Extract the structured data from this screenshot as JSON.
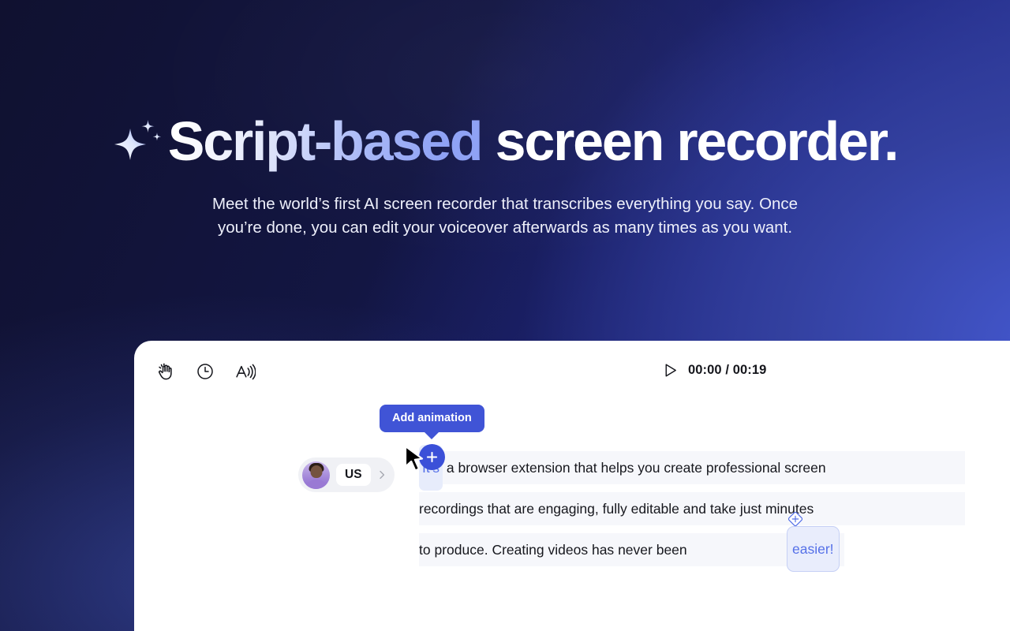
{
  "hero": {
    "headline_part1": "Script-based",
    "headline_part2": " screen recorder.",
    "subheadline": "Meet the world’s first AI screen recorder that transcribes everything you say. Once you’re done, you can edit your voiceover afterwards as many times as you want.",
    "sparkle_icon": "sparkle-icon",
    "colors": {
      "bg_dark": "#101130",
      "bg_blue": "#3a4ac2",
      "accent": "#4054d6",
      "headline_gradient_start": "#ffffff",
      "headline_gradient_end": "#8fa2f5"
    }
  },
  "app": {
    "toolbar": {
      "tools": [
        {
          "name": "hand-icon",
          "label": "Hand"
        },
        {
          "name": "clock-icon",
          "label": "Timing"
        },
        {
          "name": "voice-icon",
          "label": "Voice"
        }
      ],
      "playback": {
        "play_icon": "play-icon",
        "current_time": "00:00",
        "separator": " / ",
        "total_time": "00:19",
        "time_display": "00:00 / 00:19"
      }
    },
    "tooltip": {
      "label": "Add animation",
      "button_icon": "plus-icon",
      "cursor_icon": "cursor-arrow-icon"
    },
    "speaker": {
      "avatar": "avatar",
      "language": "US",
      "chevron": "chevron-right-icon"
    },
    "transcript": {
      "line1": {
        "highlight": "It’s",
        "rest": "a browser extension that helps you create professional screen"
      },
      "line2": {
        "text": "recordings that are engaging, fully editable and take just minutes"
      },
      "line3": {
        "prefix": "to produce. Creating videos has never been",
        "highlight": "easier!",
        "marker_icon": "diamond-plus-icon"
      }
    }
  }
}
